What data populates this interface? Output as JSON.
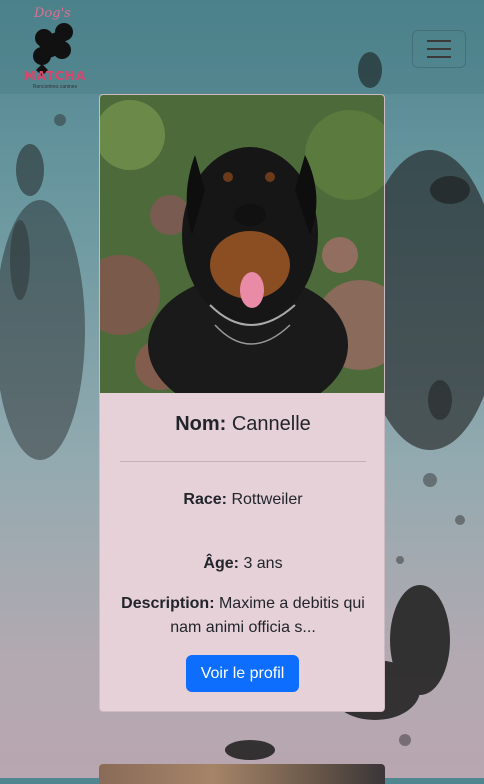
{
  "navbar": {
    "logo_top": "Dog's",
    "logo_word": "MATCHA",
    "logo_sub": "Rencontres canines",
    "toggle_icon": "hamburger-icon"
  },
  "card": {
    "image_alt": "Rottweiler",
    "name_label": "Nom:",
    "name_value": "Cannelle",
    "breed_label": "Race:",
    "breed_value": "Rottweiler",
    "age_label": "Âge:",
    "age_value": "3 ans",
    "description_label": "Description:",
    "description_value": "Maxime a debitis qui nam animi officia s...",
    "button_label": "Voir le profil"
  },
  "colors": {
    "primary_button": "#0d6efd",
    "card_background": "#e6d1d8",
    "brand_pink": "#d8466b"
  }
}
